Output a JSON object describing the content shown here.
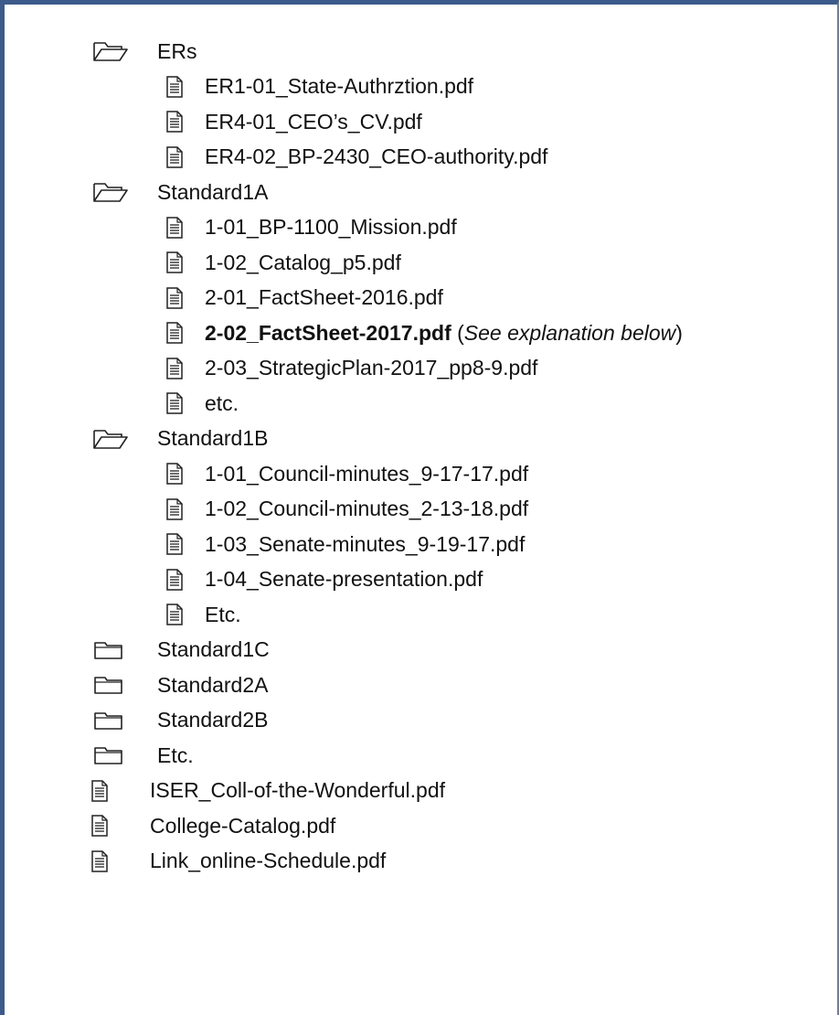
{
  "tree": {
    "ers": {
      "label": "ERs",
      "files": [
        "ER1-01_State-Authrztion.pdf",
        "ER4-01_CEO’s_CV.pdf",
        "ER4-02_BP-2430_CEO-authority.pdf"
      ]
    },
    "standard1a": {
      "label": "Standard1A",
      "files": [
        "1-01_BP-1100_Mission.pdf",
        "1-02_Catalog_p5.pdf",
        "2-01_FactSheet-2016.pdf"
      ],
      "highlight_file": "2-02_FactSheet-2017.pdf",
      "highlight_note_open": "(",
      "highlight_note": "See explanation below",
      "highlight_note_close": ")",
      "files_after": [
        "2-03_StrategicPlan-2017_pp8-9.pdf",
        "etc."
      ]
    },
    "standard1b": {
      "label": "Standard1B",
      "files": [
        "1-01_Council-minutes_9-17-17.pdf",
        "1-02_Council-minutes_2-13-18.pdf",
        "1-03_Senate-minutes_9-19-17.pdf",
        "1-04_Senate-presentation.pdf",
        "Etc."
      ]
    },
    "closed_folders": [
      "Standard1C",
      "Standard2A",
      "Standard2B",
      "Etc."
    ],
    "root_files": [
      "ISER_Coll-of-the-Wonderful.pdf",
      "College-Catalog.pdf",
      "Link_online-Schedule.pdf"
    ]
  }
}
